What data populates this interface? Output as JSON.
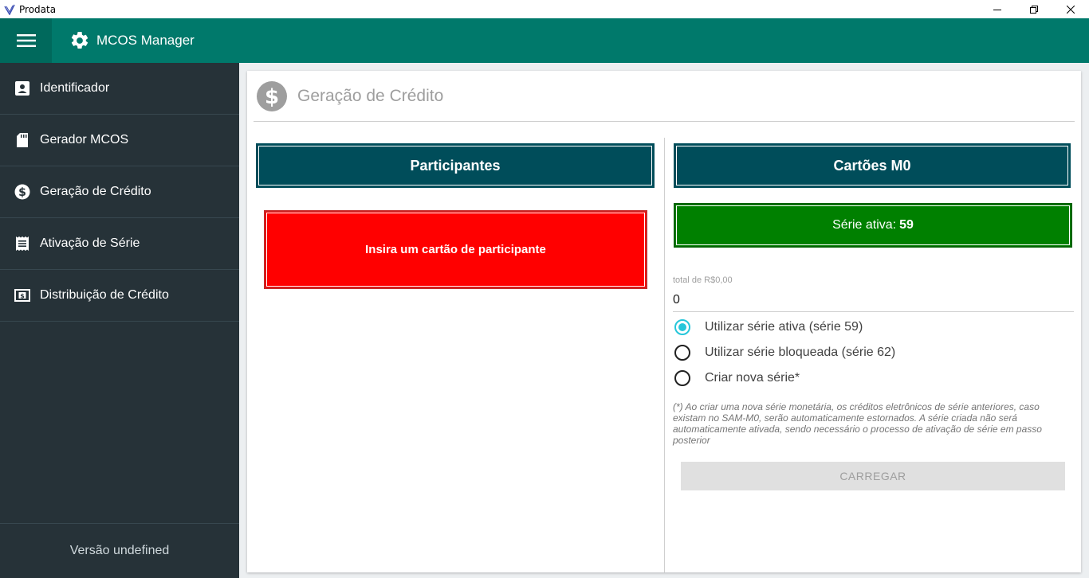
{
  "window": {
    "title": "Prodata",
    "controls": {
      "minimize_icon": "minimize-icon",
      "restore_icon": "restore-icon",
      "close_icon": "close-icon"
    }
  },
  "appbar": {
    "menu_icon": "menu-icon",
    "brand_icon": "gear-icon",
    "brand_label": "MCOS Manager",
    "color": "#00796b"
  },
  "sidebar": {
    "items": [
      {
        "label": "Identificador",
        "icon": "contact-card-icon"
      },
      {
        "label": "Gerador MCOS",
        "icon": "sd-card-icon"
      },
      {
        "label": "Geração de Crédito",
        "icon": "dollar-circle-icon"
      },
      {
        "label": "Ativação de Série",
        "icon": "receipt-icon"
      },
      {
        "label": "Distribuição de Crédito",
        "icon": "money-bill-icon"
      }
    ],
    "version": "Versão undefined",
    "background": "#263238"
  },
  "page": {
    "icon": "dollar-circle-icon",
    "title": "Geração de Crédito"
  },
  "participants": {
    "heading": "Participantes",
    "alert": "Insira um cartão de participante",
    "alert_color": "#ff0000"
  },
  "cards": {
    "heading": "Cartões M0",
    "serie_label": "Série ativa:",
    "serie_value": "59",
    "serie_color": "#008000",
    "total_label": "total de R$0,00",
    "total_value": "0",
    "options": [
      {
        "label": "Utilizar série ativa (série 59)",
        "checked": true
      },
      {
        "label": "Utilizar série bloqueada (série 62)",
        "checked": false
      },
      {
        "label": "Criar nova série*",
        "checked": false
      }
    ],
    "note": "(*) Ao criar uma nova série monetária, os créditos eletrônicos de série anteriores, caso existam no SAM-M0, serão automaticamente estornados. A série criada não será automaticamente ativada, sendo necessário o processo de ativação de série em passo posterior",
    "button": "CARREGAR",
    "heading_color": "#004d5a"
  }
}
